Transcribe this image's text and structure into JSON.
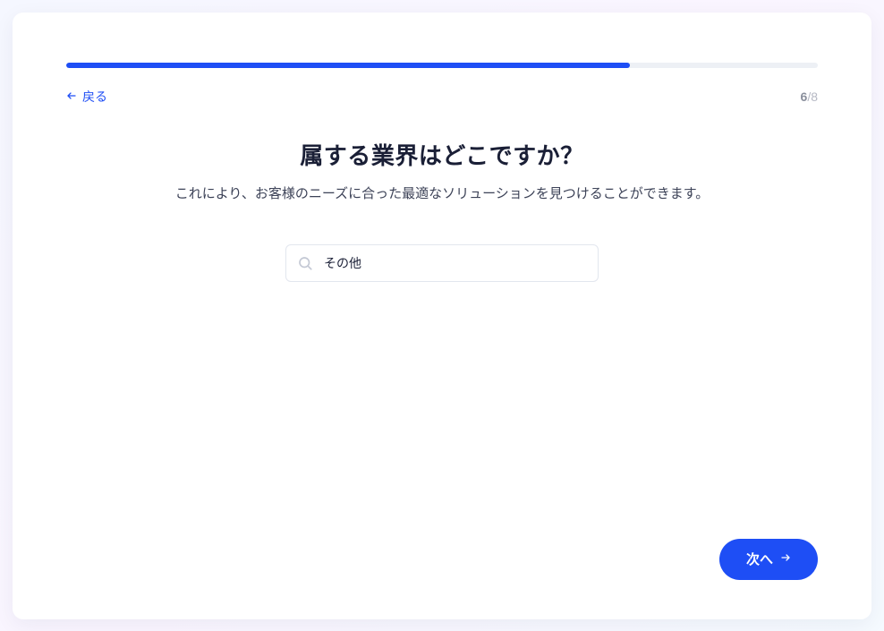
{
  "progress": {
    "percent": 75
  },
  "nav": {
    "back_label": "戻る",
    "step_current": "6",
    "step_total": "/8"
  },
  "content": {
    "heading": "属する業界はどこですか？",
    "subheading": "これにより、お客様のニーズに合った最適なソリューションを見つけることができます。"
  },
  "search": {
    "value": "その他",
    "placeholder": ""
  },
  "footer": {
    "next_label": "次へ"
  }
}
